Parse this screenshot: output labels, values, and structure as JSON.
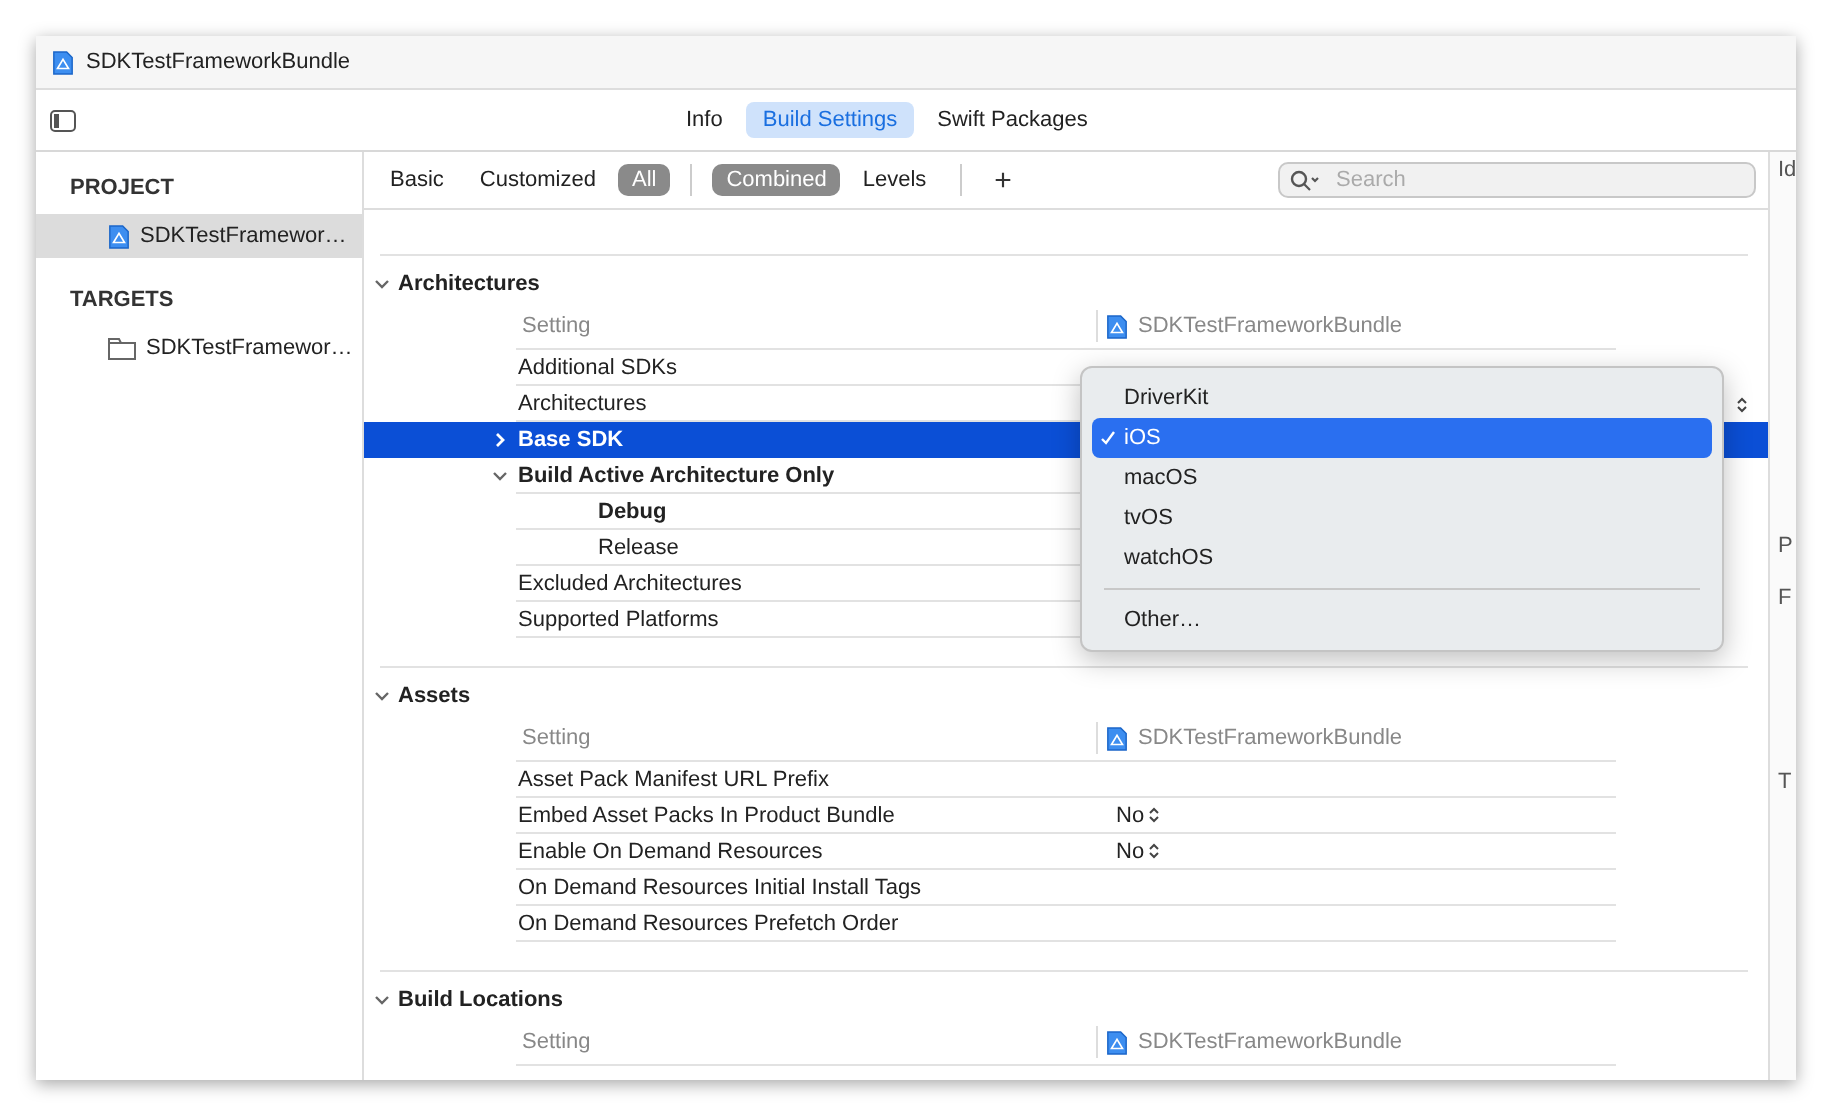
{
  "window": {
    "title": "SDKTestFrameworkBundle"
  },
  "tabs": [
    {
      "label": "Info",
      "selected": false
    },
    {
      "label": "Build Settings",
      "selected": true
    },
    {
      "label": "Swift Packages",
      "selected": false
    }
  ],
  "sidebar": {
    "sections": [
      {
        "heading": "PROJECT",
        "items": [
          {
            "label": "SDKTestFramewor…",
            "selected": true,
            "kind": "project"
          }
        ]
      },
      {
        "heading": "TARGETS",
        "items": [
          {
            "label": "SDKTestFramewor…",
            "selected": false,
            "kind": "target"
          }
        ]
      }
    ]
  },
  "filter_bar": {
    "scopes": [
      {
        "label": "Basic",
        "selected": false
      },
      {
        "label": "Customized",
        "selected": false
      },
      {
        "label": "All",
        "selected": true
      }
    ],
    "views": [
      {
        "label": "Combined",
        "selected": true
      },
      {
        "label": "Levels",
        "selected": false
      }
    ],
    "add_button": "+",
    "search": {
      "placeholder": "Search"
    }
  },
  "sections": [
    {
      "title": "Architectures",
      "expanded": true,
      "column_header": "Setting",
      "target_header": "SDKTestFrameworkBundle",
      "rows": [
        {
          "name": "Additional SDKs",
          "modified": false,
          "selected": false,
          "popup": false
        },
        {
          "name": "Architectures",
          "modified": false,
          "selected": false,
          "popup": true
        },
        {
          "name": "Base SDK",
          "modified": true,
          "selected": true,
          "popup": false,
          "expanded": false
        },
        {
          "name": "Build Active Architecture Only",
          "modified": true,
          "selected": false,
          "popup": false,
          "expanded": true,
          "children": [
            {
              "name": "Debug",
              "modified": true,
              "selected": false,
              "popup": false
            },
            {
              "name": "Release",
              "modified": false,
              "selected": false,
              "popup": false
            }
          ]
        },
        {
          "name": "Excluded Architectures",
          "modified": false,
          "selected": false,
          "popup": false
        },
        {
          "name": "Supported Platforms",
          "modified": false,
          "selected": false,
          "popup": false
        }
      ]
    },
    {
      "title": "Assets",
      "expanded": true,
      "column_header": "Setting",
      "target_header": "SDKTestFrameworkBundle",
      "rows": [
        {
          "name": "Asset Pack Manifest URL Prefix",
          "modified": false,
          "selected": false,
          "popup": false
        },
        {
          "name": "Embed Asset Packs In Product Bundle",
          "value": "No",
          "modified": false,
          "selected": false,
          "popup": true
        },
        {
          "name": "Enable On Demand Resources",
          "value": "No",
          "modified": false,
          "selected": false,
          "popup": true
        },
        {
          "name": "On Demand Resources Initial Install Tags",
          "modified": false,
          "selected": false,
          "popup": false
        },
        {
          "name": "On Demand Resources Prefetch Order",
          "modified": false,
          "selected": false,
          "popup": false
        }
      ]
    },
    {
      "title": "Build Locations",
      "expanded": true,
      "column_header": "Setting",
      "target_header": "SDKTestFrameworkBundle"
    }
  ],
  "popup_menu": {
    "items": [
      {
        "kind": "option",
        "label": "DriverKit",
        "selected": false
      },
      {
        "kind": "option",
        "label": "iOS",
        "selected": true
      },
      {
        "kind": "option",
        "label": "macOS",
        "selected": false
      },
      {
        "kind": "option",
        "label": "tvOS",
        "selected": false
      },
      {
        "kind": "option",
        "label": "watchOS",
        "selected": false
      },
      {
        "kind": "separator"
      },
      {
        "kind": "option",
        "label": "Other…",
        "selected": false
      }
    ]
  },
  "inspector": {
    "labels": [
      "Id",
      "P",
      "F",
      "T"
    ]
  }
}
